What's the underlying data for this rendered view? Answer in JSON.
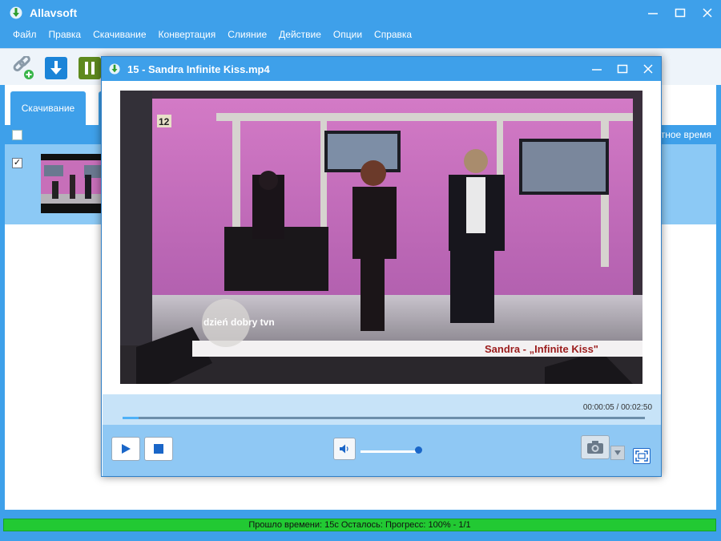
{
  "app": {
    "title": "Allavsoft",
    "window_controls": [
      "minimize",
      "maximize",
      "close"
    ]
  },
  "menu": {
    "items": [
      "Файл",
      "Правка",
      "Скачивание",
      "Конвертация",
      "Слияние",
      "Действие",
      "Опции",
      "Справка"
    ]
  },
  "toolbar": {
    "buttons": [
      "add-link-icon",
      "download-icon",
      "pause-icon"
    ]
  },
  "tabs": {
    "download_label": "Скачивание"
  },
  "list": {
    "header_time_label": "тное время",
    "row_checked": true
  },
  "status": {
    "text": "Прошло времени: 15с Осталось: Прогресс: 100% - 1/1"
  },
  "player": {
    "title": "15 - Sandra Infinite Kiss.mp4",
    "video_caption": "Sandra - „Infinite Kiss\"",
    "channel_logo": "dzień dobry tvn",
    "channel_number": "12",
    "time_readout": "00:00:05 / 00:02:50",
    "progress_fraction": 0.03,
    "volume_fraction": 1.0,
    "controls": [
      "play-icon",
      "stop-icon",
      "speaker-icon",
      "camera-icon",
      "fullscreen-icon"
    ]
  },
  "colors": {
    "accent": "#3ea0ea",
    "row_selected": "#8cc9f5",
    "status_green": "#22c933",
    "seek_fill": "#4fb1f7",
    "volume_knob": "#1a66c8"
  }
}
